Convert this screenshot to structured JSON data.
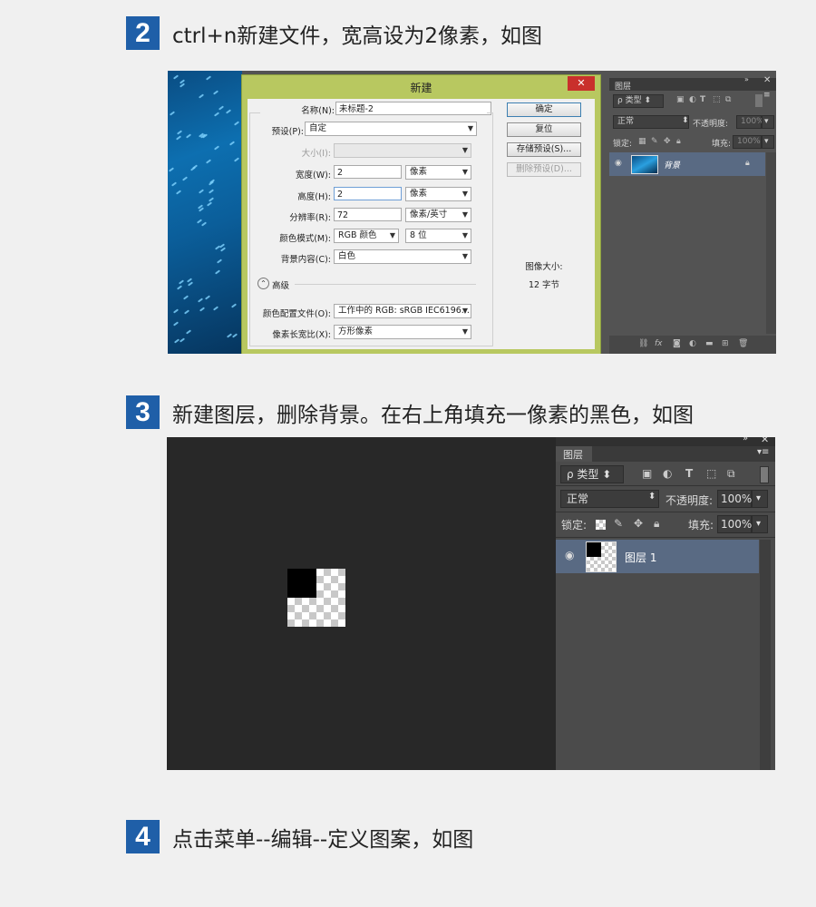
{
  "colors": {
    "step_badge": "#1f5fa8",
    "dialog_frame": "#b8c860",
    "ps_panel": "#535353",
    "canvas_dark": "#282828",
    "layer_selected": "#596a83"
  },
  "steps": [
    {
      "number": "2",
      "text": "ctrl+n新建文件，宽高设为2像素，如图"
    },
    {
      "number": "3",
      "text": "新建图层，删除背景。在右上角填充一像素的黑色，如图"
    },
    {
      "number": "4",
      "text": "点击菜单--编辑--定义图案，如图"
    }
  ],
  "new_dialog": {
    "title": "新建",
    "close": "✕",
    "name_label": "名称(N):",
    "name_value": "未标题-2",
    "preset_label": "预设(P):",
    "preset_value": "自定",
    "size_label": "大小(I):",
    "width_label": "宽度(W):",
    "width_value": "2",
    "width_unit": "像素",
    "height_label": "高度(H):",
    "height_value": "2",
    "height_unit": "像素",
    "resolution_label": "分辨率(R):",
    "resolution_value": "72",
    "resolution_unit": "像素/英寸",
    "color_mode_label": "颜色模式(M):",
    "color_mode_value": "RGB 颜色",
    "bit_depth": "8 位",
    "background_label": "背景内容(C):",
    "background_value": "白色",
    "advanced_label": "高级",
    "color_profile_label": "颜色配置文件(O):",
    "color_profile_value": "工作中的 RGB: sRGB IEC6196...",
    "pixel_aspect_label": "像素长宽比(X):",
    "pixel_aspect_value": "方形像素",
    "ok": "确定",
    "reset": "复位",
    "save_preset": "存储预设(S)...",
    "delete_preset": "删除预设(D)...",
    "image_size_label": "图像大小:",
    "image_size_value": "12 字节"
  },
  "layers_panel_1": {
    "tab": "图层",
    "filter": "ρ 类型",
    "blend_mode": "正常",
    "opacity_label": "不透明度:",
    "opacity": "100%",
    "lock_label": "锁定:",
    "fill_label": "填充:",
    "fill": "100%",
    "layer_name": "背景"
  },
  "layers_panel_2": {
    "tab": "图层",
    "filter": "ρ 类型",
    "blend_mode": "正常",
    "opacity_label": "不透明度:",
    "opacity": "100%",
    "lock_label": "锁定:",
    "fill_label": "填充:",
    "fill": "100%",
    "layer_name": "图层 1"
  }
}
